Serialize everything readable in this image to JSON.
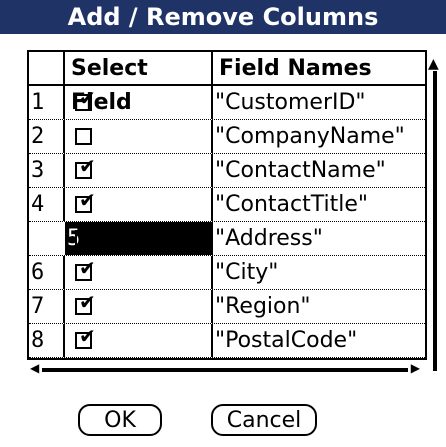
{
  "dialog": {
    "title": "Add / Remove Columns"
  },
  "grid": {
    "headers": {
      "num": "",
      "select": "Select Field",
      "name": "Field Names"
    },
    "rows": [
      {
        "num": "1",
        "selected": true,
        "name": "\"CustomerID\""
      },
      {
        "num": "2",
        "selected": false,
        "name": "\"CompanyName\""
      },
      {
        "num": "3",
        "selected": true,
        "name": "\"ContactName\""
      },
      {
        "num": "4",
        "selected": true,
        "name": "\"ContactTitle\""
      },
      {
        "num": "5",
        "selected": false,
        "name": "\"Address\""
      },
      {
        "num": "6",
        "selected": true,
        "name": "\"City\""
      },
      {
        "num": "7",
        "selected": true,
        "name": "\"Region\""
      },
      {
        "num": "8",
        "selected": true,
        "name": "\"PostalCode\""
      }
    ],
    "highlighted_row": "5"
  },
  "buttons": {
    "ok": "OK",
    "cancel": "Cancel"
  }
}
